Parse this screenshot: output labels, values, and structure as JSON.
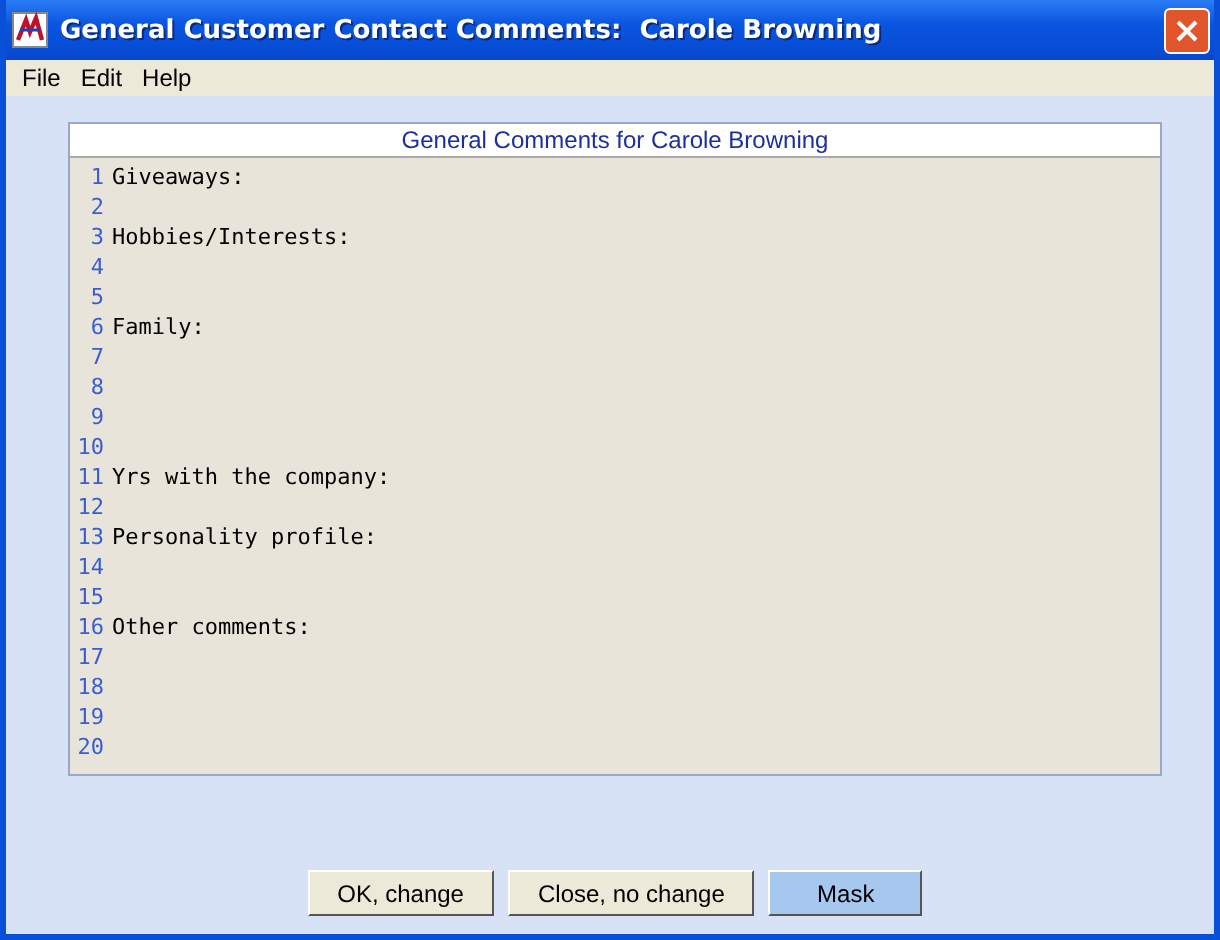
{
  "window": {
    "title": "General Customer Contact Comments:  Carole Browning"
  },
  "menu": [
    {
      "label": "File"
    },
    {
      "label": "Edit"
    },
    {
      "label": "Help"
    }
  ],
  "comments": {
    "title": "General Comments for Carole Browning",
    "lines": [
      {
        "number": "1",
        "text": "Giveaways:"
      },
      {
        "number": "2"
      },
      {
        "number": "3",
        "text": "Hobbies/Interests:"
      },
      {
        "number": "4"
      },
      {
        "number": "5"
      },
      {
        "number": "6",
        "text": "Family:"
      },
      {
        "number": "7"
      },
      {
        "number": "8"
      },
      {
        "number": "9"
      },
      {
        "number": "10"
      },
      {
        "number": "11",
        "text": "Yrs with the company:"
      },
      {
        "number": "12"
      },
      {
        "number": "13",
        "text": "Personality profile:"
      },
      {
        "number": "14"
      },
      {
        "number": "15"
      },
      {
        "number": "16",
        "text": "Other comments:"
      },
      {
        "number": "17"
      },
      {
        "number": "18"
      },
      {
        "number": "19"
      },
      {
        "number": "20"
      }
    ]
  },
  "buttons": [
    {
      "label": "OK, change",
      "selected": false
    },
    {
      "label": "Close, no change",
      "selected": false
    },
    {
      "label": "Mask",
      "selected": true
    }
  ]
}
